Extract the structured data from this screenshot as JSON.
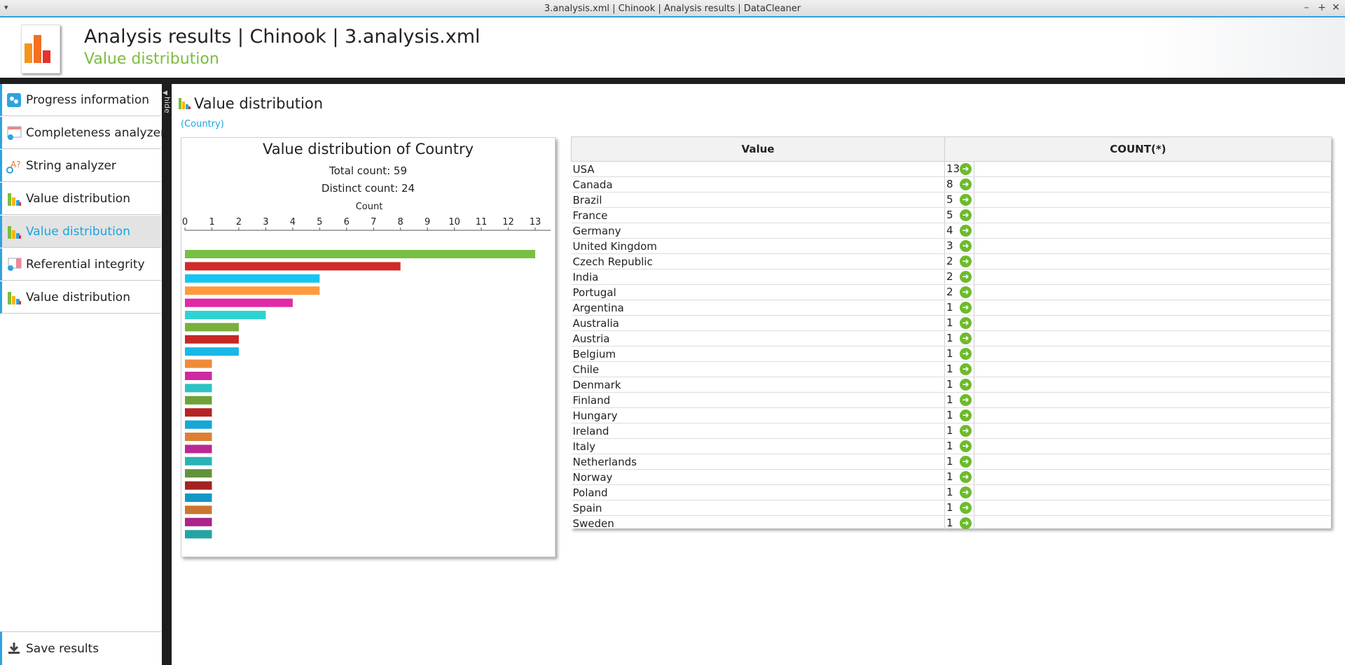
{
  "window": {
    "title": "3.analysis.xml | Chinook | Analysis results | DataCleaner",
    "minimize": "–",
    "maximize": "+",
    "close": "✕",
    "menu": "▾"
  },
  "header": {
    "title": "Analysis results | Chinook | 3.analysis.xml",
    "subtitle": "Value distribution"
  },
  "sidebar": {
    "items": [
      {
        "label": "Progress information",
        "icon": "progress-icon"
      },
      {
        "label": "Completeness analyzer",
        "icon": "completeness-icon"
      },
      {
        "label": "String analyzer",
        "icon": "string-analyzer-icon"
      },
      {
        "label": "Value distribution",
        "icon": "value-distribution-icon"
      },
      {
        "label": "Value distribution",
        "icon": "value-distribution-icon",
        "active": true
      },
      {
        "label": "Referential integrity",
        "icon": "referential-integrity-icon"
      },
      {
        "label": "Value distribution",
        "icon": "value-distribution-icon"
      }
    ],
    "hide_label": "hide",
    "save_label": "Save results"
  },
  "main": {
    "title": "Value distribution",
    "column_link": "(Country)"
  },
  "chart_data": {
    "type": "bar",
    "title": "Value distribution of Country",
    "total_text": "Total count: 59",
    "distinct_text": "Distinct count: 24",
    "xlabel": "Count",
    "xlim": [
      0,
      13
    ],
    "ticks": [
      0,
      1,
      2,
      3,
      4,
      5,
      6,
      7,
      8,
      9,
      10,
      11,
      12,
      13
    ],
    "categories": [
      "USA",
      "Canada",
      "Brazil",
      "France",
      "Germany",
      "United Kingdom",
      "Czech Republic",
      "India",
      "Portugal",
      "Argentina",
      "Australia",
      "Austria",
      "Belgium",
      "Chile",
      "Denmark",
      "Finland",
      "Hungary",
      "Ireland",
      "Italy",
      "Netherlands",
      "Norway",
      "Poland",
      "Spain",
      "Sweden"
    ],
    "values": [
      13,
      8,
      5,
      5,
      4,
      3,
      2,
      2,
      2,
      1,
      1,
      1,
      1,
      1,
      1,
      1,
      1,
      1,
      1,
      1,
      1,
      1,
      1,
      1
    ],
    "colors": [
      "#79bf44",
      "#d12a2a",
      "#17c5f2",
      "#ff9a3c",
      "#e02aa6",
      "#2dd3d3",
      "#79af3c",
      "#c62727",
      "#18b8e8",
      "#ef8a38",
      "#cc2aa0",
      "#2bc3c3",
      "#6ea238",
      "#b52424",
      "#15a8d6",
      "#dd8034",
      "#bc2794",
      "#28b4b4",
      "#62933a",
      "#a52222",
      "#1398c4",
      "#cb7630",
      "#ab248a",
      "#25a4a4"
    ],
    "grid": false,
    "legend": "none"
  },
  "table": {
    "headers": [
      "Value",
      "COUNT(*)"
    ],
    "drill_icon": "➜",
    "rows": [
      {
        "value": "USA",
        "count": "13"
      },
      {
        "value": "Canada",
        "count": "8"
      },
      {
        "value": "Brazil",
        "count": "5"
      },
      {
        "value": "France",
        "count": "5"
      },
      {
        "value": "Germany",
        "count": "4"
      },
      {
        "value": "United Kingdom",
        "count": "3"
      },
      {
        "value": "Czech Republic",
        "count": "2"
      },
      {
        "value": "India",
        "count": "2"
      },
      {
        "value": "Portugal",
        "count": "2"
      },
      {
        "value": "Argentina",
        "count": "1"
      },
      {
        "value": "Australia",
        "count": "1"
      },
      {
        "value": "Austria",
        "count": "1"
      },
      {
        "value": "Belgium",
        "count": "1"
      },
      {
        "value": "Chile",
        "count": "1"
      },
      {
        "value": "Denmark",
        "count": "1"
      },
      {
        "value": "Finland",
        "count": "1"
      },
      {
        "value": "Hungary",
        "count": "1"
      },
      {
        "value": "Ireland",
        "count": "1"
      },
      {
        "value": "Italy",
        "count": "1"
      },
      {
        "value": "Netherlands",
        "count": "1"
      },
      {
        "value": "Norway",
        "count": "1"
      },
      {
        "value": "Poland",
        "count": "1"
      },
      {
        "value": "Spain",
        "count": "1"
      },
      {
        "value": "Sweden",
        "count": "1"
      }
    ]
  }
}
